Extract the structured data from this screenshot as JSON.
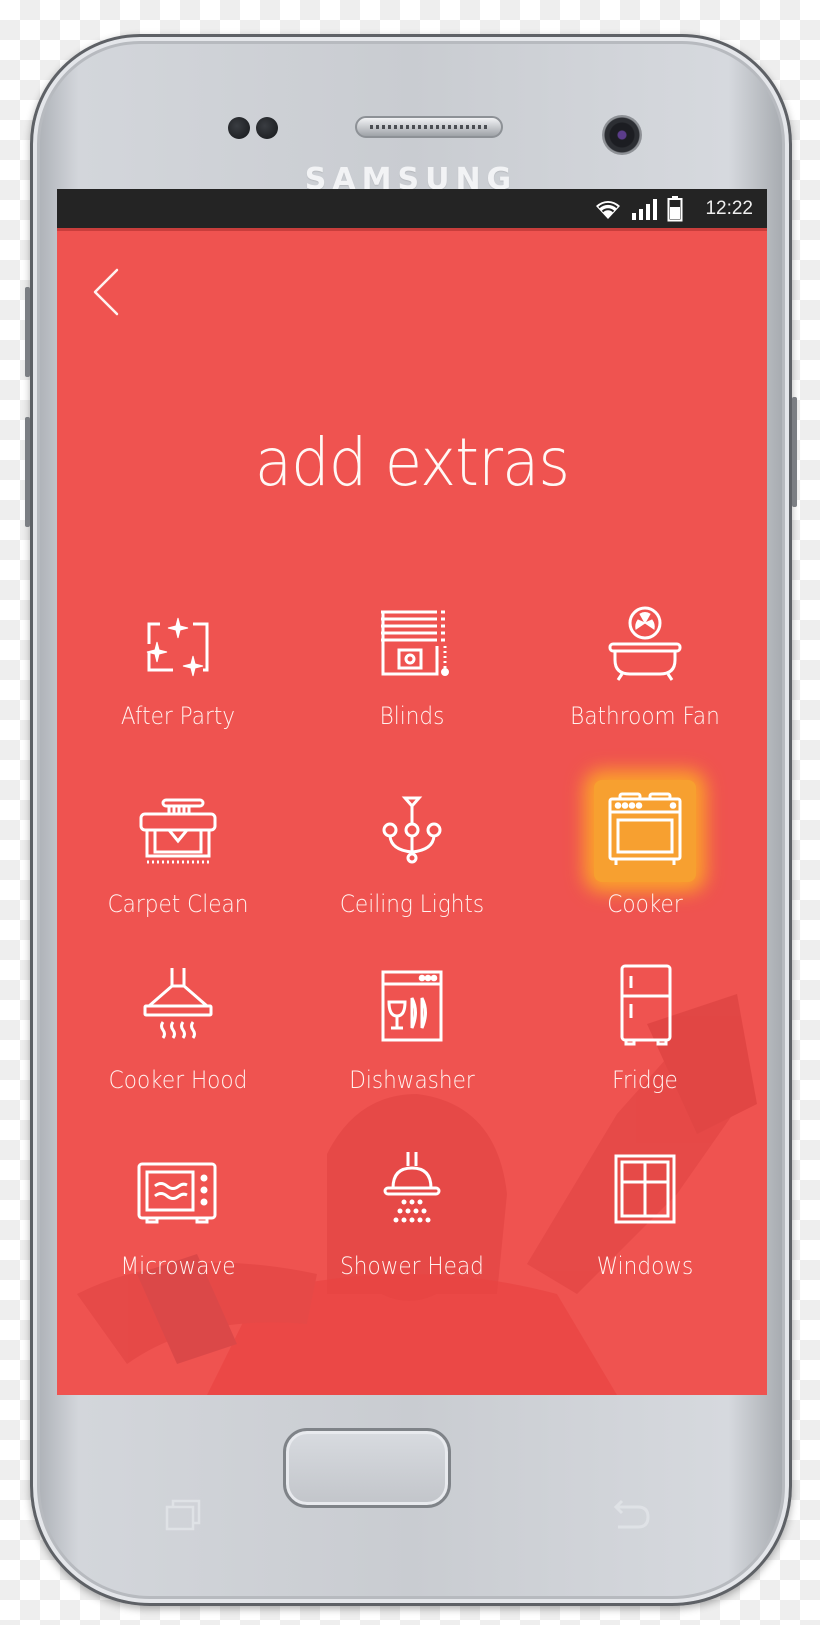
{
  "device": {
    "brand": "SAMSUNG"
  },
  "status_bar": {
    "time": "12:22",
    "icons": [
      "wifi-icon",
      "signal-icon",
      "battery-icon"
    ]
  },
  "header": {
    "back_icon": "chevron-left-icon",
    "title": "add extras"
  },
  "colors": {
    "background": "#ef5350",
    "status_bar": "#242424",
    "selected_highlight": "#f7a030",
    "text": "#ffffff"
  },
  "extras": [
    {
      "label": "After Party",
      "icon": "sparkles-icon",
      "selected": false
    },
    {
      "label": "Blinds",
      "icon": "blinds-icon",
      "selected": false
    },
    {
      "label": "Bathroom Fan",
      "icon": "bathroom-fan-icon",
      "selected": false
    },
    {
      "label": "Carpet Clean",
      "icon": "carpet-clean-icon",
      "selected": false
    },
    {
      "label": "Ceiling Lights",
      "icon": "chandelier-icon",
      "selected": false
    },
    {
      "label": "Cooker",
      "icon": "cooker-icon",
      "selected": true
    },
    {
      "label": "Cooker Hood",
      "icon": "cooker-hood-icon",
      "selected": false
    },
    {
      "label": "Dishwasher",
      "icon": "dishwasher-icon",
      "selected": false
    },
    {
      "label": "Fridge",
      "icon": "fridge-icon",
      "selected": false
    },
    {
      "label": "Microwave",
      "icon": "microwave-icon",
      "selected": false
    },
    {
      "label": "Shower Head",
      "icon": "shower-head-icon",
      "selected": false
    },
    {
      "label": "Windows",
      "icon": "window-icon",
      "selected": false
    }
  ],
  "nav_keys": {
    "recents_icon": "recents-icon",
    "home_icon": "home-button",
    "back_icon": "back-arrow-icon"
  }
}
